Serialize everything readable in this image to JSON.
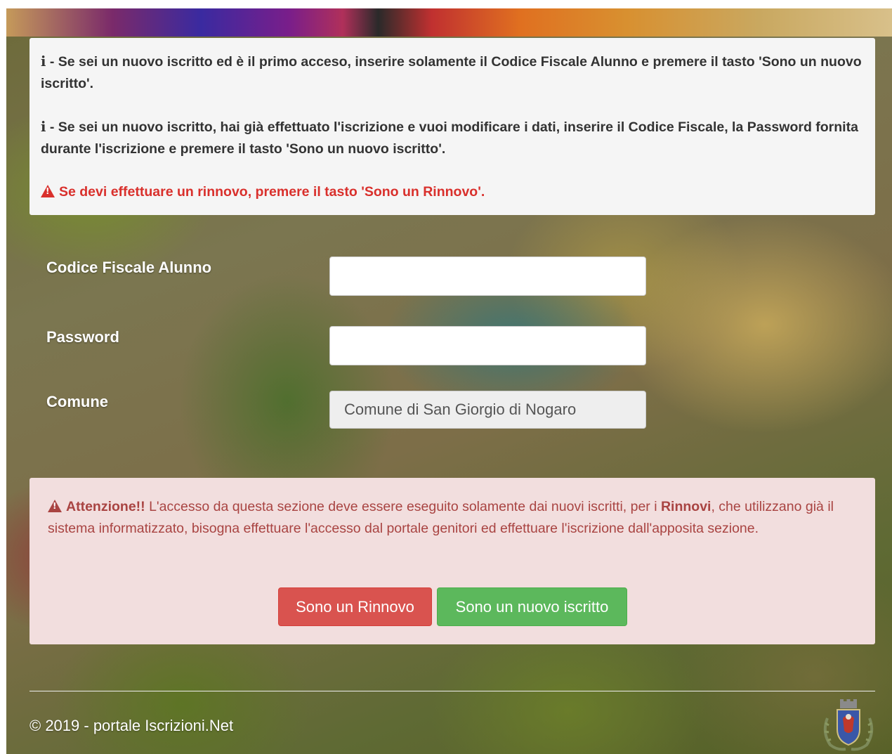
{
  "info": {
    "line1_prefix": "i",
    "line1_text": " - Se sei un nuovo iscritto ed è il primo acceso, inserire solamente il Codice Fiscale Alunno e premere il tasto 'Sono un nuovo iscritto'.",
    "line2_prefix": "i",
    "line2_text": " - Se sei un nuovo iscritto, hai già effettuato l'iscrizione e vuoi modificare i dati, inserire il Codice Fiscale, la Password fornita durante l'iscrizione e premere il tasto 'Sono un nuovo iscritto'.",
    "renewal_notice": "Se devi effettuare un rinnovo, premere il tasto 'Sono un Rinnovo'."
  },
  "form": {
    "codice_label": "Codice Fiscale Alunno",
    "codice_value": "",
    "password_label": "Password",
    "password_value": "",
    "comune_label": "Comune",
    "comune_value": "Comune di San Giorgio di Nogaro"
  },
  "warning": {
    "title": "Attenzione!!",
    "text_part1": " L'accesso da questa sezione deve essere eseguito solamente dai nuovi iscritti, per i ",
    "highlight": "Rinnovi",
    "text_part2": ", che utilizzano già il sistema informatizzato, bisogna effettuare l'accesso dal portale genitori ed effettuare l'iscrizione dall'apposita sezione."
  },
  "buttons": {
    "renewal": "Sono un Rinnovo",
    "new_enrollment": "Sono un nuovo iscritto"
  },
  "footer": {
    "copyright": "© 2019 - portale Iscrizioni.Net"
  },
  "colors": {
    "danger": "#d9534f",
    "success": "#5cb85c",
    "warning_bg": "#f2dede",
    "warning_text": "#a94442",
    "info_bg": "#f5f5f5"
  }
}
